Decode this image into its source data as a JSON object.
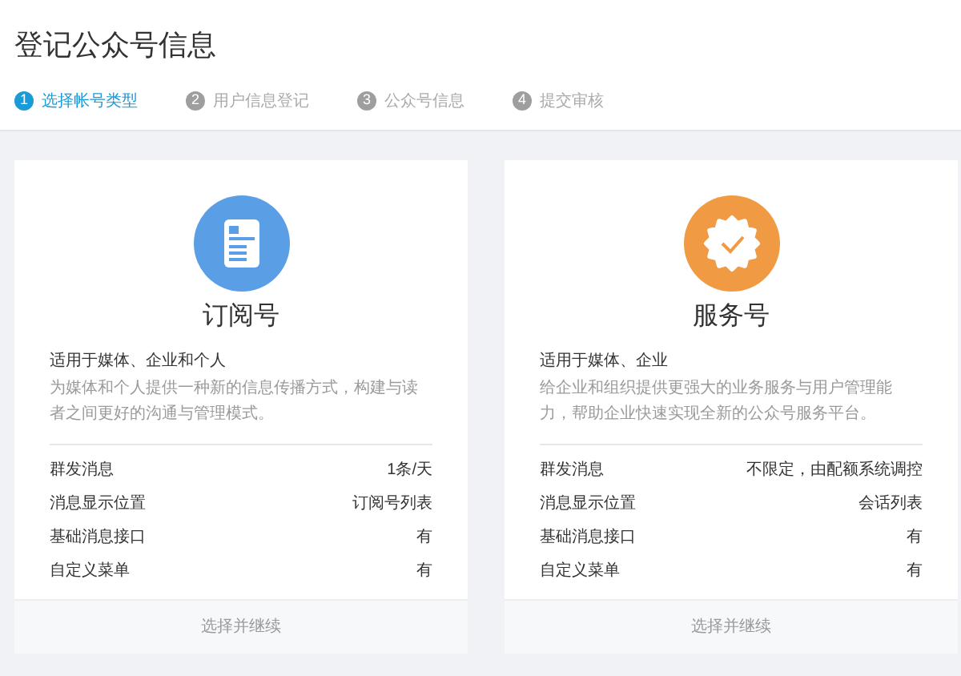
{
  "title": "登记公众号信息",
  "steps": [
    {
      "number": "1",
      "label": "选择帐号类型",
      "selected": true
    },
    {
      "number": "2",
      "label": "用户信息登记",
      "selected": false
    },
    {
      "number": "3",
      "label": "公众号信息",
      "selected": false
    },
    {
      "number": "4",
      "label": "提交审核",
      "selected": false
    }
  ],
  "cards": [
    {
      "kind": "subscription",
      "name": "订阅号",
      "audience": "适用于媒体、企业和个人",
      "description": "为媒体和个人提供一种新的信息传播方式，构建与读者之间更好的沟通与管理模式。",
      "features": [
        {
          "label": "群发消息",
          "value": "1条/天"
        },
        {
          "label": "消息显示位置",
          "value": "订阅号列表"
        },
        {
          "label": "基础消息接口",
          "value": "有"
        },
        {
          "label": "自定义菜单",
          "value": "有"
        }
      ],
      "action": "选择并继续"
    },
    {
      "kind": "service",
      "name": "服务号",
      "audience": "适用于媒体、企业",
      "description": "给企业和组织提供更强大的业务服务与用户管理能力，帮助企业快速实现全新的公众号服务平台。",
      "features": [
        {
          "label": "群发消息",
          "value": "不限定，由配额系统调控"
        },
        {
          "label": "消息显示位置",
          "value": "会话列表"
        },
        {
          "label": "基础消息接口",
          "value": "有"
        },
        {
          "label": "自定义菜单",
          "value": "有"
        }
      ],
      "action": "选择并继续"
    }
  ]
}
